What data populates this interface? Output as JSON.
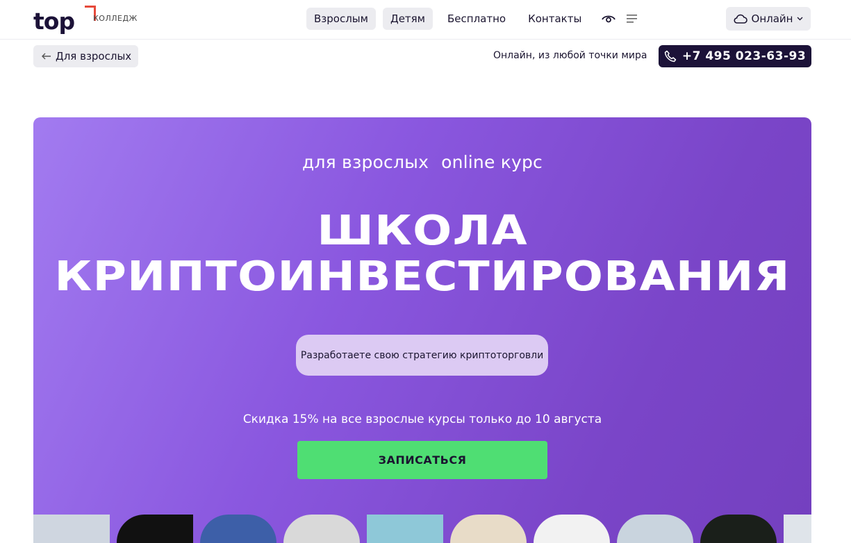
{
  "header": {
    "logo_text": "top",
    "logo_sub": "КОЛЛЕДЖ",
    "nav": [
      {
        "label": "Взрослым",
        "pill": true
      },
      {
        "label": "Детям",
        "pill": true
      },
      {
        "label": "Бесплатно",
        "pill": false
      },
      {
        "label": "Контакты",
        "pill": false
      }
    ],
    "online_label": "Онлайн"
  },
  "subbar": {
    "back_label": "Для взрослых",
    "location_text": "Онлайн, из любой точки мира",
    "phone": "+7 495 023-63-93"
  },
  "hero": {
    "tag_1": "для взрослых",
    "tag_2": "online курс",
    "title_line_1": "ШКОЛА",
    "title_line_2": "КРИПТОИНВЕСТИРОВАНИЯ",
    "benefit": "Разработаете свою стратегию криптоторговли",
    "discount": "Скидка 15% на все взрослые курсы только до 10 августа",
    "cta_label": "ЗАПИСАТЬСЯ"
  },
  "colors": {
    "brand_dark": "#1c1238",
    "logo_accent": "#e64a3b",
    "hero_purple": "#8a57df",
    "cta_green": "#4fde73",
    "pill_gray": "#ececf0"
  },
  "strip_tiles": [
    {
      "name": "strip-image-keyboard",
      "shape": "square",
      "color": "#cfd6e0"
    },
    {
      "name": "strip-image-dark",
      "shape": "tl",
      "color": "#111111"
    },
    {
      "name": "strip-image-coin-blue",
      "shape": "round",
      "color": "#3d5fa8"
    },
    {
      "name": "strip-image-gray",
      "shape": "round",
      "color": "#d9d9d9"
    },
    {
      "name": "strip-image-hand-coin",
      "shape": "square",
      "color": "#8ec8d8"
    },
    {
      "name": "strip-image-calculator",
      "shape": "round",
      "color": "#e8dcc8"
    },
    {
      "name": "strip-image-desk",
      "shape": "round",
      "color": "#f2f2f2"
    },
    {
      "name": "strip-image-laptop",
      "shape": "round",
      "color": "#c9d4de"
    },
    {
      "name": "strip-image-chart-dark",
      "shape": "round",
      "color": "#1a1f1a"
    },
    {
      "name": "strip-image-silver",
      "shape": "square",
      "color": "#dfe4ea"
    }
  ]
}
